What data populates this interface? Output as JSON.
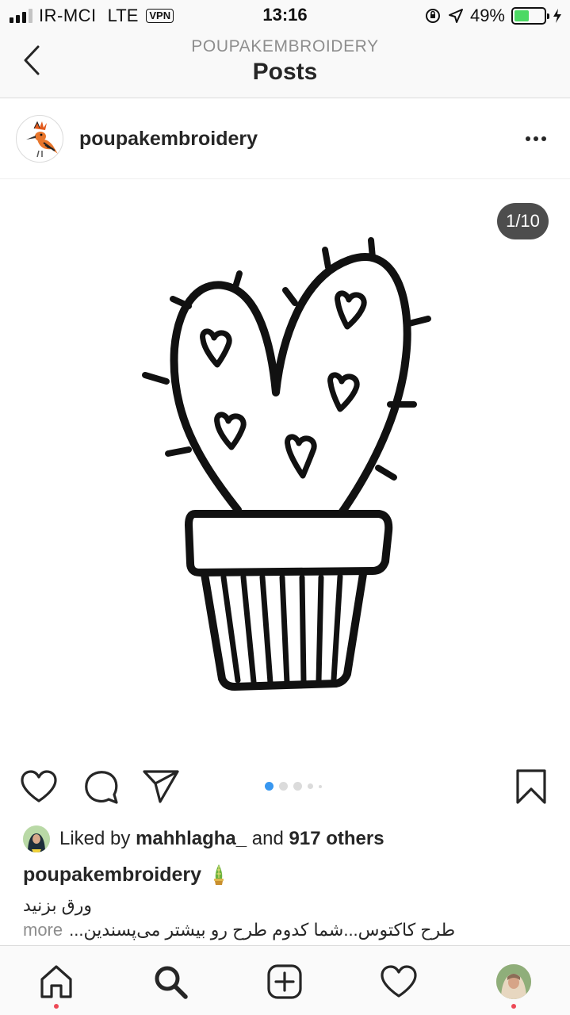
{
  "status_bar": {
    "carrier": "IR-MCI",
    "network": "LTE",
    "vpn": "VPN",
    "time": "13:16",
    "battery_percent": "49%",
    "battery_level": 0.49,
    "signal_bars": 4,
    "signal_active": 3
  },
  "header": {
    "account": "POUPAKEMBROIDERY",
    "title": "Posts"
  },
  "post": {
    "username": "poupakembroidery",
    "counter": "1/10",
    "current_slide": 1,
    "total_slides": 10,
    "liked_prefix": "Liked by",
    "liked_user": "mahhlagha_",
    "liked_and": "and",
    "liked_others": "917 others",
    "caption_user": "poupakembroidery",
    "caption_line1": "ورق بزنید",
    "caption_line2": "طرح کاکتوس...شما کدوم طرح رو بیشتر می‌پسندین...",
    "more": "more"
  },
  "colors": {
    "accent_blue": "#3897f0",
    "notification_red": "#ed4956",
    "battery_green": "#4cd964"
  },
  "icons": {
    "actions": [
      "heart-icon",
      "comment-icon",
      "share-icon",
      "bookmark-icon"
    ],
    "tabs": [
      "home-icon",
      "search-icon",
      "add-post-icon",
      "activity-heart-icon",
      "profile-avatar"
    ]
  }
}
